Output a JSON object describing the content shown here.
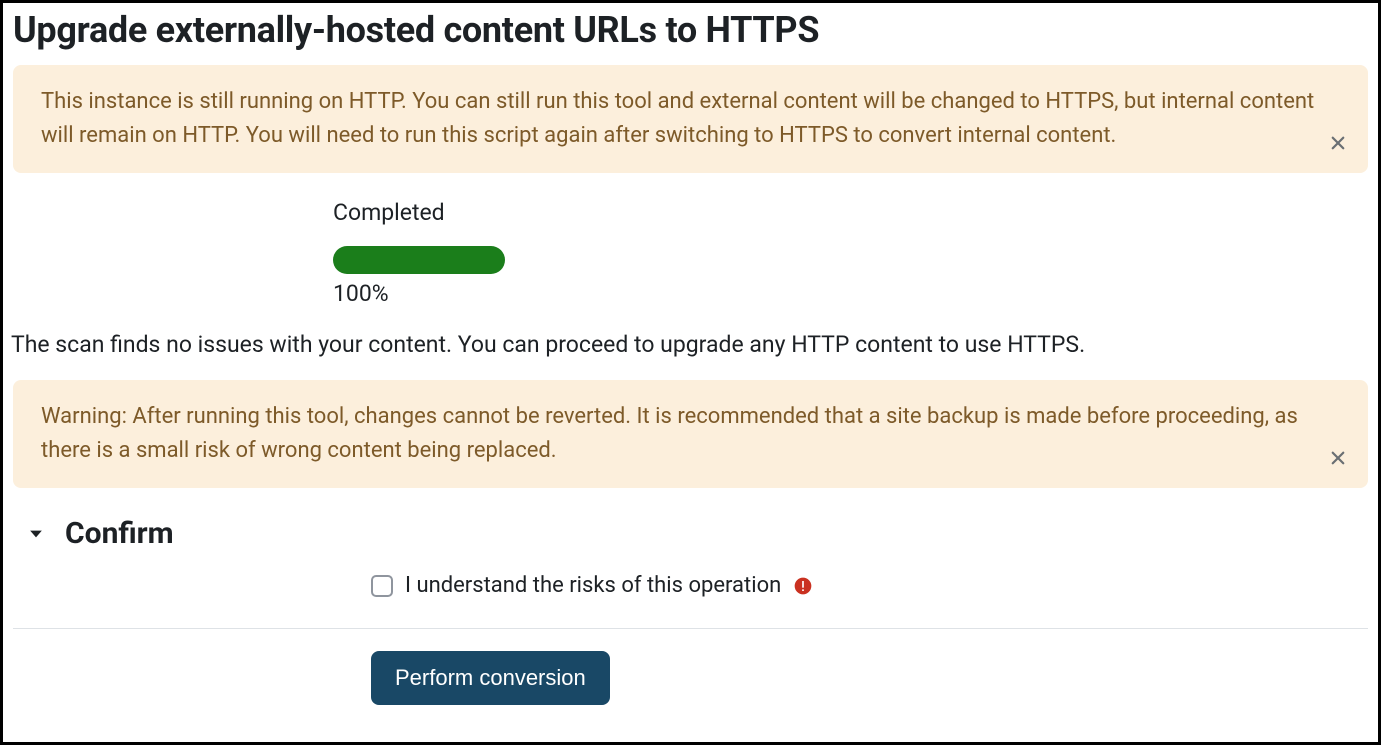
{
  "page": {
    "title": "Upgrade externally-hosted content URLs to HTTPS"
  },
  "alerts": {
    "http_notice": "This instance is still running on HTTP. You can still run this tool and external content will be changed to HTTPS, but internal content will remain on HTTP. You will need to run this script again after switching to HTTPS to convert internal content.",
    "revert_warning": "Warning: After running this tool, changes cannot be reverted. It is recommended that a site backup is made before proceeding, as there is a small risk of wrong content being replaced."
  },
  "progress": {
    "status_label": "Completed",
    "percent_text": "100%",
    "percent_value": 100
  },
  "scan": {
    "result_text": "The scan finds no issues with your content. You can proceed to upgrade any HTTP content to use HTTPS."
  },
  "confirm": {
    "heading": "Confirm",
    "checkbox_label": "I understand the risks of this operation"
  },
  "actions": {
    "perform_label": "Perform conversion"
  }
}
